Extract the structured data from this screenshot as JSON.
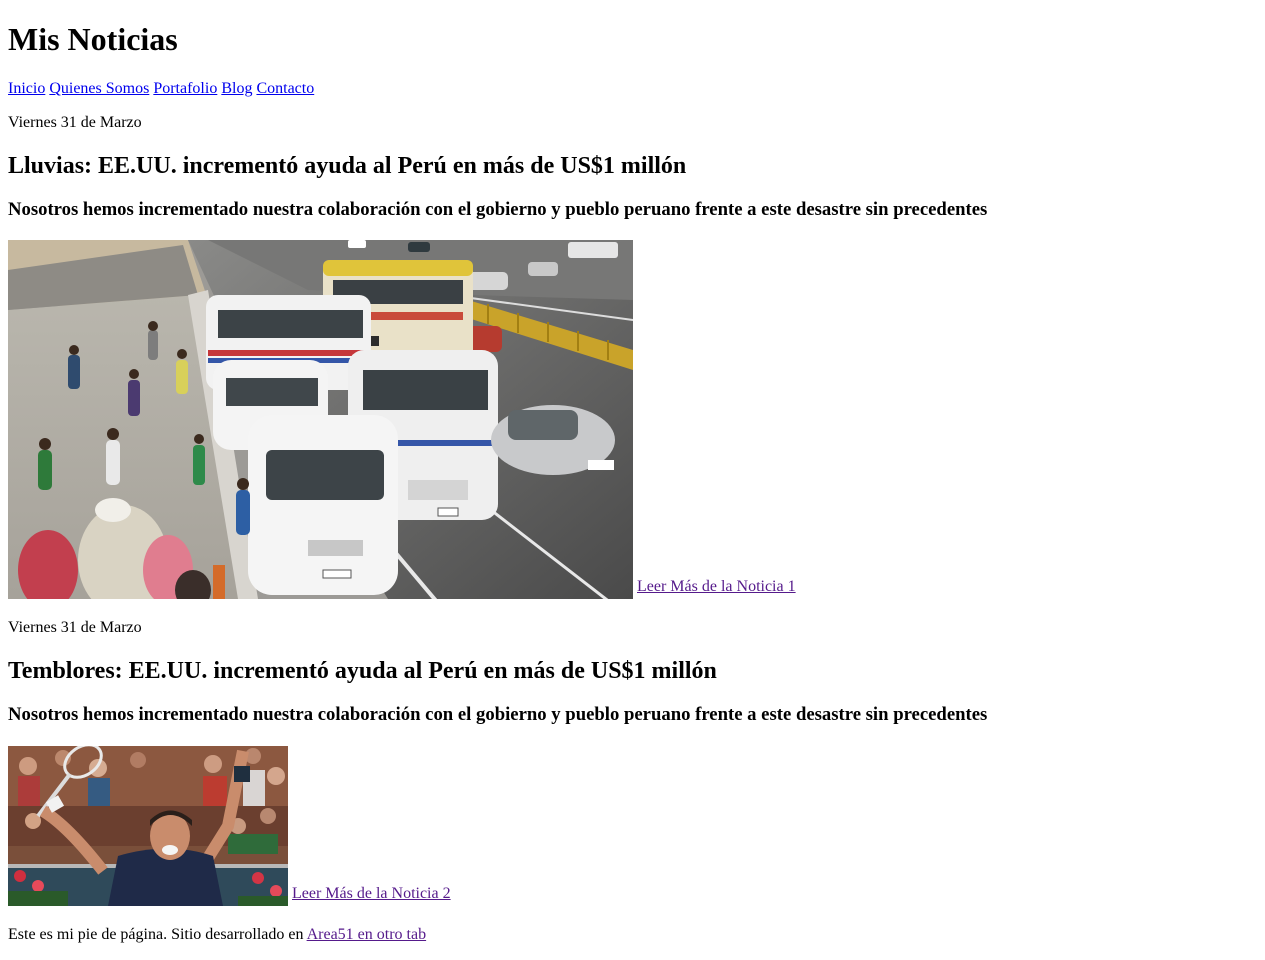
{
  "site": {
    "title": "Mis Noticias"
  },
  "nav": {
    "items": [
      {
        "label": "Inicio"
      },
      {
        "label": "Quienes Somos"
      },
      {
        "label": "Portafolio"
      },
      {
        "label": "Blog"
      },
      {
        "label": "Contacto"
      }
    ]
  },
  "articles": [
    {
      "date": "Viernes 31 de Marzo",
      "headline": "Lluvias: EE.UU. incrementó ayuda al Perú en más de US$1 millón",
      "subheadline": "Nosotros hemos incrementado nuestra colaboración con el gobierno y pueblo peruano frente a este desastre sin precedentes",
      "image_icon": "street-traffic-photo",
      "read_more": "Leer Más de la Noticia 1"
    },
    {
      "date": "Viernes 31 de Marzo",
      "headline": "Temblores: EE.UU. incrementó ayuda al Perú en más de US$1 millón",
      "subheadline": "Nosotros hemos incrementado nuestra colaboración con el gobierno y pueblo peruano frente a este desastre sin precedentes",
      "image_icon": "tennis-player-photo",
      "read_more": "Leer Más de la Noticia 2"
    }
  ],
  "footer": {
    "text": "Este es mi pie de página. Sitio desarrollado en ",
    "link": "Area51 en otro tab"
  },
  "colors": {
    "link": "#0000ee",
    "visited_link": "#551a8b"
  }
}
